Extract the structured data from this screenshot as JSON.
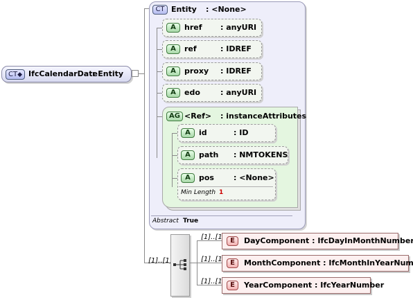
{
  "root": {
    "badge": "CT",
    "name": "IfcCalendarDate",
    "type": ": Entity"
  },
  "entity": {
    "badge": "CT",
    "name": "Entity",
    "type": ": <None>",
    "abstract_label": "Abstract",
    "abstract_value": "True",
    "attributes": [
      {
        "badge": "A",
        "name": "href",
        "type": ": anyURI"
      },
      {
        "badge": "A",
        "name": "ref",
        "type": ": IDREF"
      },
      {
        "badge": "A",
        "name": "proxy",
        "type": ": IDREF"
      },
      {
        "badge": "A",
        "name": "edo",
        "type": ": anyURI"
      }
    ],
    "group": {
      "badge": "AG",
      "name": "<Ref>",
      "type": ": instanceAttributes",
      "attributes": [
        {
          "badge": "A",
          "name": "id",
          "type": ": ID"
        },
        {
          "badge": "A",
          "name": "path",
          "type": ": NMTOKENS"
        },
        {
          "badge": "A",
          "name": "pos",
          "type": ": <None>",
          "facet_label": "Min Length",
          "facet_value": "1"
        }
      ]
    }
  },
  "sequence": {
    "cardinality": "[1]..[1]",
    "elements": [
      {
        "badge": "E",
        "label": "DayComponent : IfcDayInMonthNumber",
        "cardinality": "[1]..[1]"
      },
      {
        "badge": "E",
        "label": "MonthComponent : IfcMonthInYearNumber",
        "cardinality": "[1]..[1]"
      },
      {
        "badge": "E",
        "label": "YearComponent : IfcYearNumber",
        "cardinality": "[1]..[1]"
      }
    ]
  },
  "colors": {
    "entity_panel": "#eeeefa",
    "group_panel": "#e4f6e0",
    "element_box": "#fdf0f0",
    "facet_value": "#cc0000"
  }
}
